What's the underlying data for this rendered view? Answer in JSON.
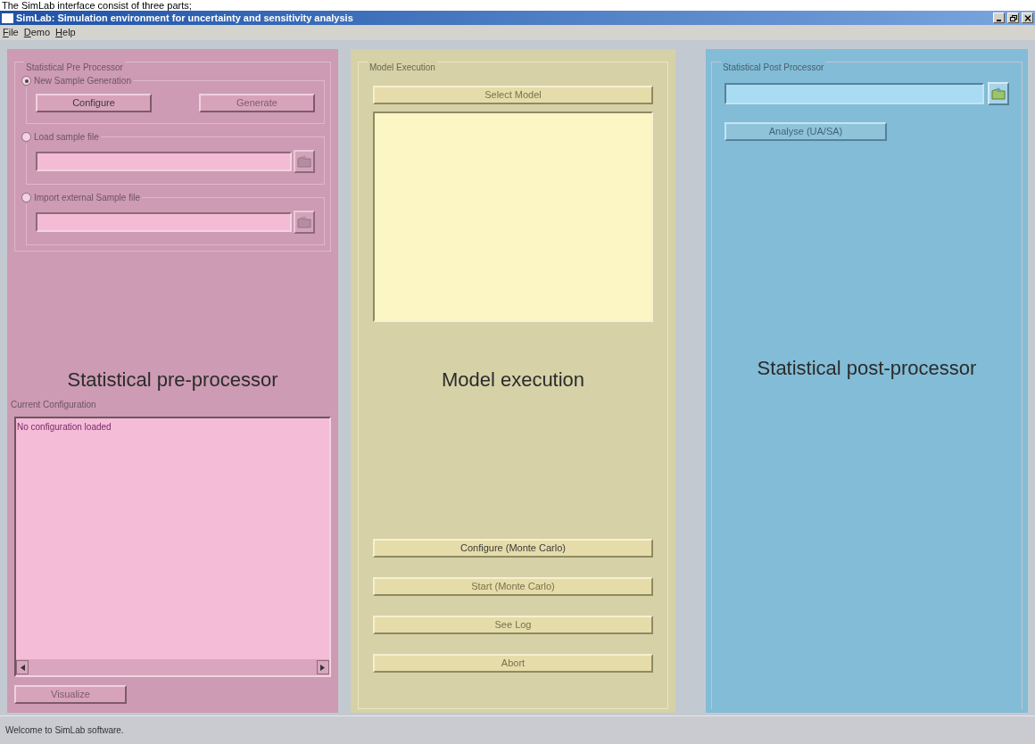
{
  "caption": "The SimLab interface consist of three parts;",
  "window": {
    "title": "SimLab: Simulation environment for uncertainty and sensitivity analysis"
  },
  "menu": [
    {
      "label": "File"
    },
    {
      "label": "Demo"
    },
    {
      "label": "Help"
    }
  ],
  "pre_processor": {
    "title": "Statistical Pre Processor",
    "options": [
      {
        "kind": "buttons",
        "label": "New Sample Generation",
        "selected": true,
        "buttons": [
          {
            "label": "Configure",
            "disabled": false
          },
          {
            "label": "Generate",
            "disabled": true
          }
        ]
      },
      {
        "kind": "file",
        "label": "Load sample file",
        "selected": false
      },
      {
        "kind": "file",
        "label": "Import external Sample file",
        "selected": false
      }
    ],
    "overlay_label": "Statistical pre-processor",
    "config_title": "Current Configuration",
    "config_text": "No configuration loaded",
    "visualize_button": {
      "label": "Visualize",
      "disabled": true
    }
  },
  "model_execution": {
    "title": "Model Execution",
    "select_button": {
      "label": "Select Model",
      "disabled": true
    },
    "overlay_label": "Model execution",
    "buttons": [
      {
        "label": "Configure (Monte Carlo)",
        "disabled": false
      },
      {
        "label": "Start (Monte Carlo)",
        "disabled": true
      },
      {
        "label": "See Log",
        "disabled": true
      },
      {
        "label": "Abort",
        "disabled": true
      }
    ]
  },
  "post_processor": {
    "title": "Statistical Post Processor",
    "analyse_button": {
      "label": "Analyse (UA/SA)",
      "disabled": true
    },
    "overlay_label": "Statistical post-processor"
  },
  "status_bar": "Welcome to SimLab software."
}
